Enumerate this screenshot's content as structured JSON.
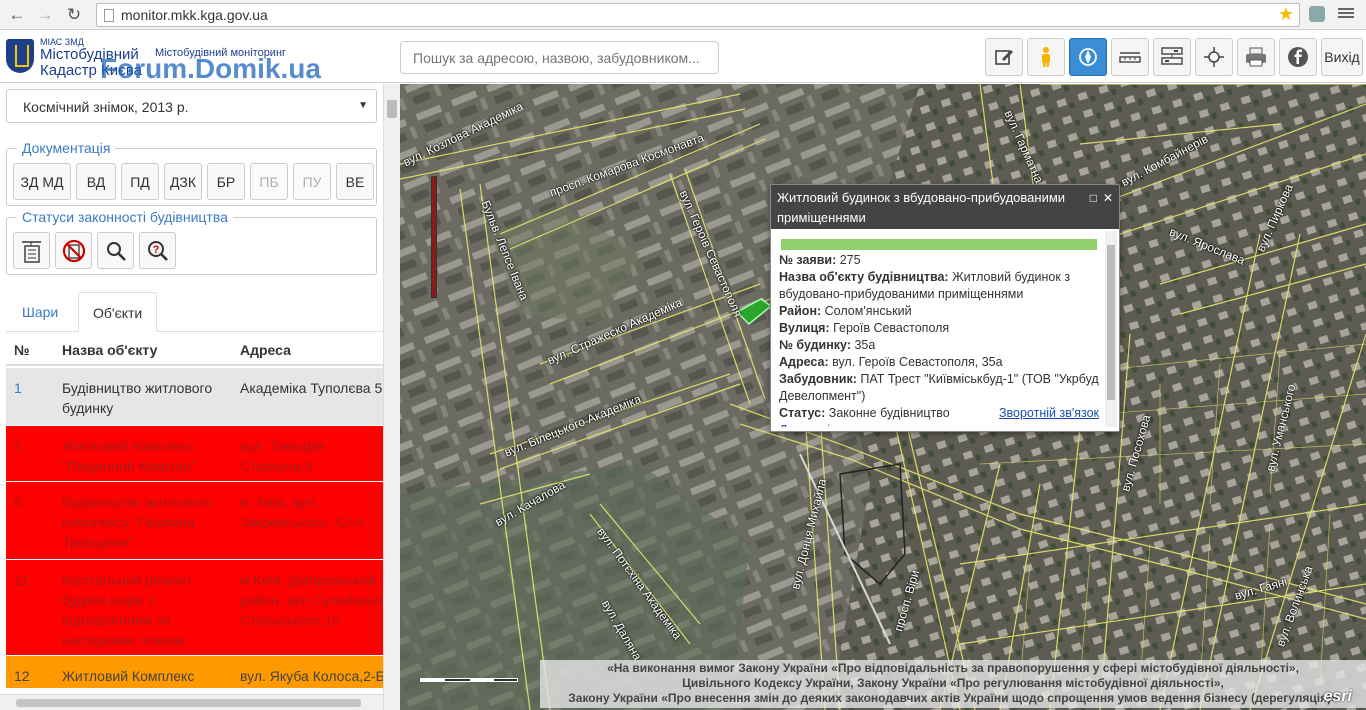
{
  "browser": {
    "url": "monitor.mkk.kga.gov.ua"
  },
  "header": {
    "logo_small": "МІАС ЗМД",
    "logo_line1": "Містобудівний",
    "logo_line2": "Кадастр Києва",
    "subtitle": "Містобудівний моніторинг",
    "watermark": "Forum.Domik.ua",
    "search_placeholder": "Пошук за адресою, назвою, забудовником...",
    "exit_label": "Вихід",
    "tool_icons": [
      "edit-icon",
      "street-view-icon",
      "compass-icon",
      "measure-icon",
      "layers-config-icon",
      "crosshair-icon",
      "print-icon",
      "facebook-icon"
    ]
  },
  "sidebar": {
    "basemap": "Космічний знімок, 2013 р.",
    "documentation": {
      "legend": "Документація",
      "buttons": [
        {
          "label": "ЗД МД",
          "disabled": false
        },
        {
          "label": "ВД",
          "disabled": false
        },
        {
          "label": "ПД",
          "disabled": false
        },
        {
          "label": "ДЗК",
          "disabled": false
        },
        {
          "label": "БР",
          "disabled": false
        },
        {
          "label": "ПБ",
          "disabled": true
        },
        {
          "label": "ПУ",
          "disabled": true
        },
        {
          "label": "ВЕ",
          "disabled": false
        }
      ]
    },
    "statuses": {
      "legend": "Статуси законності будівництва",
      "icons": [
        "legal-construction-icon",
        "prohibited-construction-icon",
        "inspection-icon",
        "questionable-icon"
      ]
    },
    "tabs": [
      "Шари",
      "Об'єкти"
    ],
    "table": {
      "headers": [
        "№",
        "Назва об'єкту",
        "Адреса"
      ],
      "rows": [
        {
          "num": "1",
          "name": "Будівництво житлового будинку",
          "address": "Академіка Туполєва 5",
          "color": "#e6e6e6",
          "text": "#333333"
        },
        {
          "num": "5",
          "name": "Житловий Комплекс \"Південний Квартал\"",
          "address": "вул. Тимофія Строкача,9",
          "color": "#ff0000",
          "text": "#a61a1a"
        },
        {
          "num": "6",
          "name": "Будівництво житлового комплексу \"Перлина Троєщини\"",
          "address": "м. Київ, вул. Закревського, 42-А",
          "color": "#ff0000",
          "text": "#a61a1a"
        },
        {
          "num": "11",
          "name": "Капітальний ремонт будівлі кафе з відновленням за наслідками пожежі",
          "address": "м.Київ, Дніпровський район, вул.Сулеймана Стальського,19",
          "color": "#ff0000",
          "text": "#a61a1a"
        },
        {
          "num": "12",
          "name": "Житловий Комплекс \"Сонячна Брама\"",
          "address": "вул. Якуба Колоса,2-Б",
          "color": "#ff9900",
          "text": "#444444"
        }
      ]
    }
  },
  "map": {
    "streets": [
      {
        "label": "вул. Козлова Академіка"
      },
      {
        "label": "просп. Комарова Космонавта"
      },
      {
        "label": "вул. Героїв Севастополя"
      },
      {
        "label": "вул. Гарматна"
      },
      {
        "label": "вул. Комбайнерів"
      },
      {
        "label": "вул. Ярослава"
      },
      {
        "label": "вул. Пиркова"
      },
      {
        "label": "Бульв. Лепсе Івана"
      },
      {
        "label": "вул. Стражеско Академіка"
      },
      {
        "label": "вул. Білецького Академіка"
      },
      {
        "label": "вул. Качалова"
      },
      {
        "label": "вул. Потєхіна Академіка"
      },
      {
        "label": "вул. Донця Михайла"
      },
      {
        "label": "вул. Даляна"
      },
      {
        "label": "просп. Віри"
      },
      {
        "label": "вул. Посохова"
      },
      {
        "label": "вул. Уманського"
      },
      {
        "label": "вул. Гаяні"
      },
      {
        "label": "вул. Волинська"
      }
    ],
    "legal_notice": [
      "«На виконання вимог Закону України «Про відповідальність за правопорушення у сфері містобудівної діяльності»,",
      "Цивільного Кодексу України, Закону України «Про регулювання містобудівної діяльності»,",
      "Закону України «Про внесення змін до деяких законодавчих актів України щодо спрощення умов ведення бізнесу (дерегуляція)»"
    ],
    "esri": "esri"
  },
  "popup": {
    "title": "Житловий будинок з вбудовано-прибудованими приміщеннями",
    "status_color": "#92d16b",
    "fields": [
      {
        "label": "№ заяви:",
        "value": "275"
      },
      {
        "label": "Назва об'єкту будівництва:",
        "value": "Житловий будинок з вбудовано-прибудованими приміщеннями"
      },
      {
        "label": "Район:",
        "value": "Солом'янський"
      },
      {
        "label": "Вулиця:",
        "value": "Героїв Севастополя"
      },
      {
        "label": "№ будинку:",
        "value": "35а"
      },
      {
        "label": "Адреса:",
        "value": "вул. Героїв Севастополя, 35а"
      },
      {
        "label": "Забудовник:",
        "value": "ПАТ Трест \"Київміськбуд-1\" (ТОВ \"Укрбуд Девелопмент\")"
      },
      {
        "label": "Статус:",
        "value": "Законне будівництво"
      }
    ],
    "feedback_link": "Зворотній зв'язок",
    "details_link": "Детальніше"
  }
}
